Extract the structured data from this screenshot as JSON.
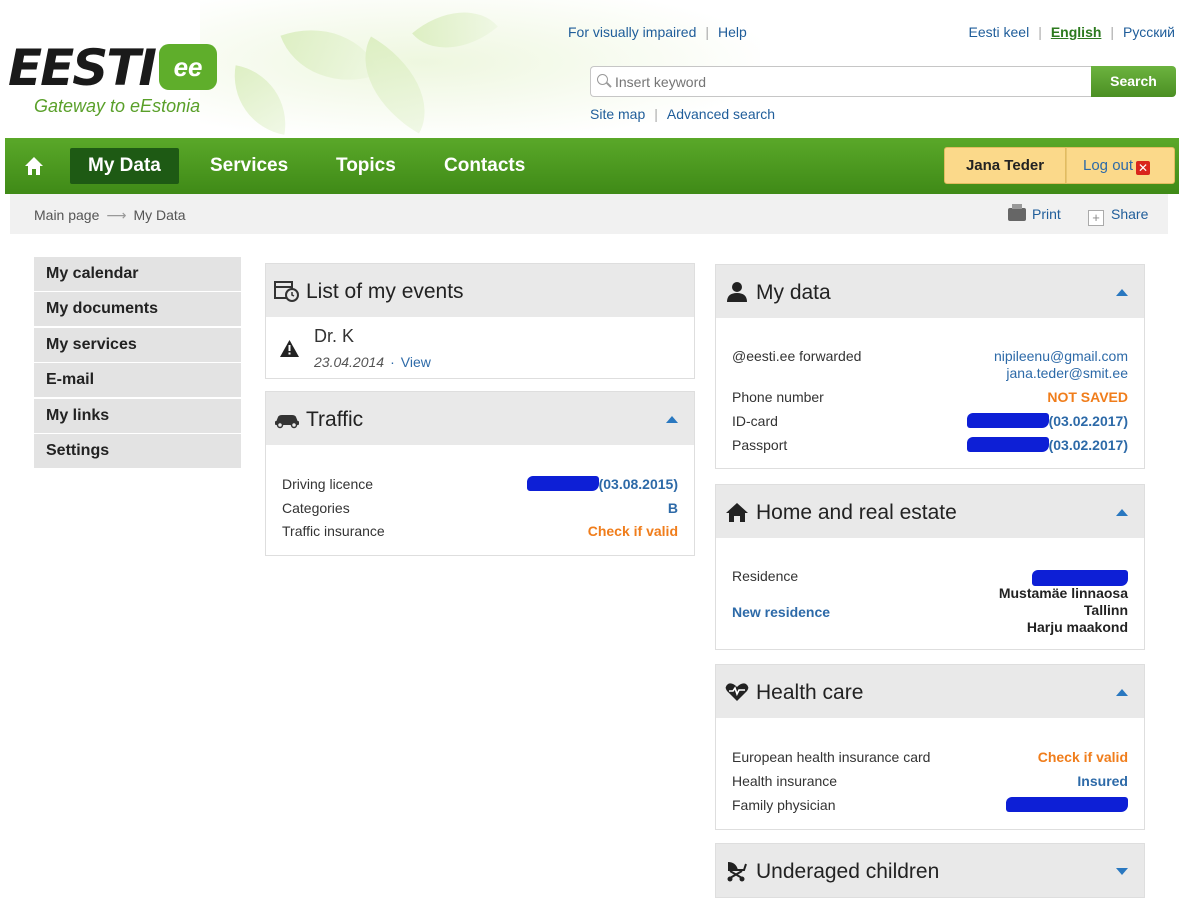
{
  "header": {
    "logo_word": "EESTI",
    "logo_badge": "ee",
    "logo_tagline": "Gateway to eEstonia",
    "top_links": [
      "For visually impaired",
      "Help"
    ],
    "languages": [
      "Eesti keel",
      "English",
      "Русский"
    ],
    "search_placeholder": "Insert keyword",
    "search_button": "Search",
    "sub_links": [
      "Site map",
      "Advanced search"
    ]
  },
  "nav": {
    "items": [
      "My Data",
      "Services",
      "Topics",
      "Contacts"
    ],
    "user_name": "Jana Teder",
    "logout_label": "Log out"
  },
  "breadcrumb": {
    "items": [
      "Main page",
      "My Data"
    ],
    "print_label": "Print",
    "share_label": "Share"
  },
  "sidebar": {
    "items": [
      "My calendar",
      "My documents",
      "My services",
      "E-mail",
      "My links",
      "Settings"
    ]
  },
  "events": {
    "title": "List of my events",
    "item_title": "Dr. K",
    "item_date": "23.04.2014",
    "item_link": "View"
  },
  "traffic": {
    "title": "Traffic",
    "driving_licence_label": "Driving licence",
    "driving_licence_value": "(03.08.2015)",
    "categories_label": "Categories",
    "categories_value": "B",
    "insurance_label": "Traffic insurance",
    "insurance_value": "Check if valid"
  },
  "my_data": {
    "title": "My data",
    "forward_label": "@eesti.ee forwarded",
    "forward_email_1": "nipileenu@gmail.com",
    "forward_email_2": "jana.teder@smit.ee",
    "phone_label": "Phone number",
    "phone_value": "NOT SAVED",
    "idcard_label": "ID-card",
    "idcard_value": "(03.02.2017)",
    "passport_label": "Passport",
    "passport_value": "(03.02.2017)"
  },
  "home": {
    "title": "Home and real estate",
    "residence_label": "Residence",
    "new_residence_link": "New residence",
    "address_line_1": "Mustamäe linnaosa",
    "address_line_2": "Tallinn",
    "address_line_3": "Harju maakond"
  },
  "health": {
    "title": "Health care",
    "ehic_label": "European health insurance card",
    "ehic_value": "Check if valid",
    "insurance_label": "Health insurance",
    "insurance_value": "Insured",
    "physician_label": "Family physician"
  },
  "children": {
    "title": "Underaged children"
  },
  "colors": {
    "green": "#4b9a20",
    "dark_green": "#1e5a14",
    "link_blue": "#2d6aa8",
    "orange": "#f07d1b",
    "redaction": "#0d1fd6"
  },
  "icons": [
    "home-icon",
    "search-icon",
    "printer-icon",
    "plus-icon",
    "calendar-clock-icon",
    "warning-icon",
    "car-icon",
    "person-icon",
    "house-icon",
    "heart-icon",
    "stroller-icon",
    "close-icon"
  ]
}
